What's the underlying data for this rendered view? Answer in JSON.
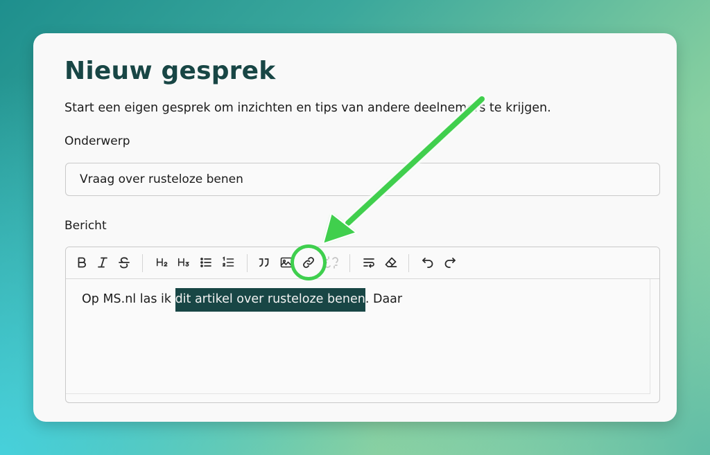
{
  "page": {
    "title": "Nieuw gesprek",
    "subtitle": "Start een eigen gesprek om inzichten en tips van andere deelnemers te krijgen."
  },
  "subject": {
    "label": "Onderwerp",
    "value": "Vraag over rusteloze benen"
  },
  "message": {
    "label": "Bericht",
    "text_before": "Op MS.nl las ik ",
    "text_selected": "dit artikel over rusteloze benen",
    "text_after": ". Daar"
  },
  "toolbar": {
    "heading2_label": "H2",
    "heading3_label": "H3",
    "icons": [
      "bold-icon",
      "italic-icon",
      "strikethrough-icon",
      "heading-2-icon",
      "heading-3-icon",
      "bullet-list-icon",
      "numbered-list-icon",
      "quote-icon",
      "image-icon",
      "link-icon",
      "unlink-icon",
      "hard-break-icon",
      "clear-format-icon",
      "undo-icon",
      "redo-icon"
    ],
    "highlighted": "link-icon"
  },
  "colors": {
    "brand_dark": "#184645",
    "annotation_green": "#3fcf4e"
  }
}
